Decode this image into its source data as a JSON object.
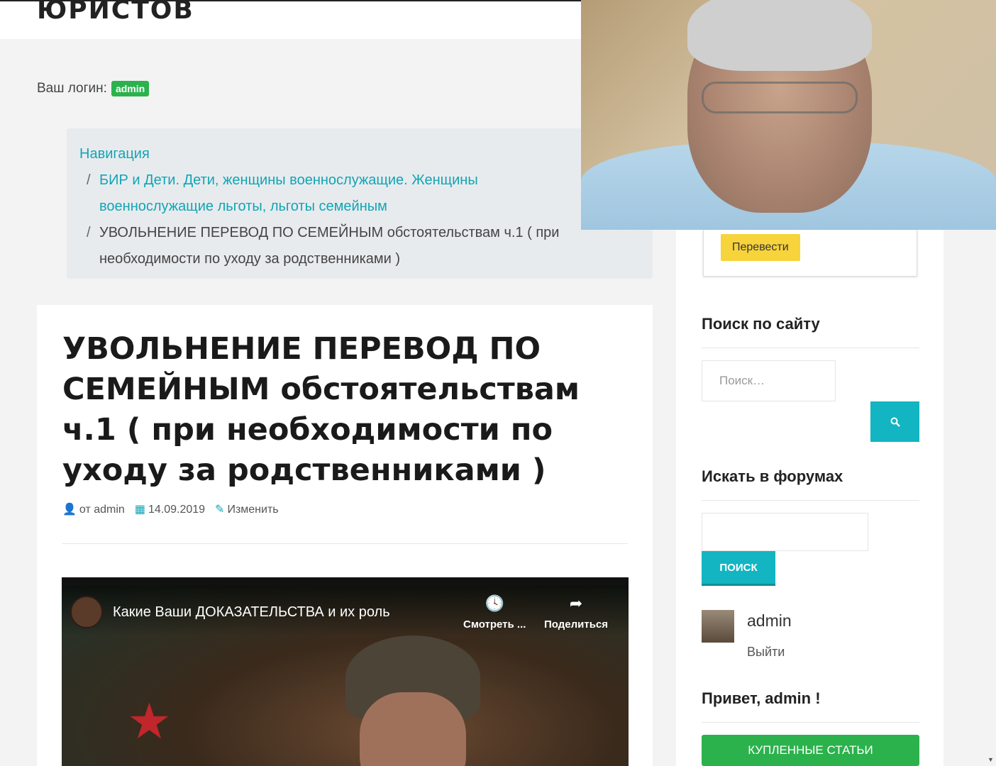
{
  "header": {
    "site_title": "ЮРИСТОВ"
  },
  "login": {
    "label": "Ваш логин:",
    "badge": "admin"
  },
  "breadcrumb": {
    "home": "Навигация",
    "separator": "/",
    "parent": "БИР и Дети. Дети, женщины военнослужащие. Женщины военнослужащие льготы, льготы семейным",
    "current": "УВОЛЬНЕНИЕ ПЕРЕВОД ПО СЕМЕЙНЫМ обстоятельствам ч.1 ( при необходимости по уходу за родственниками )"
  },
  "article": {
    "title": "УВОЛЬНЕНИЕ ПЕРЕВОД ПО СЕМЕЙНЫМ обстоятельствам ч.1 ( при необходимости по уходу за родственниками )",
    "author": "от admin",
    "date": "14.09.2019",
    "edit": "Изменить"
  },
  "video": {
    "title": "Какие Ваши ДОКАЗАТЕЛЬСТВА и их роль",
    "watch_later": "Смотреть ...",
    "share": "Поделиться",
    "channel_icon": "channel-logo-icon"
  },
  "sidebar": {
    "translate_button": "Перевести",
    "search_title": "Поиск по сайту",
    "search_placeholder": "Поиск…",
    "forum_title": "Искать в форумах",
    "forum_button": "ПОИСК",
    "user_name": "admin",
    "logout": "Выйти",
    "hello": "Привет, admin !",
    "bought_button": "КУПЛЕННЫЕ СТАТЬИ"
  },
  "colors": {
    "accent": "#12b5c1",
    "green": "#2bb24c",
    "yellow": "#f7d33c"
  }
}
